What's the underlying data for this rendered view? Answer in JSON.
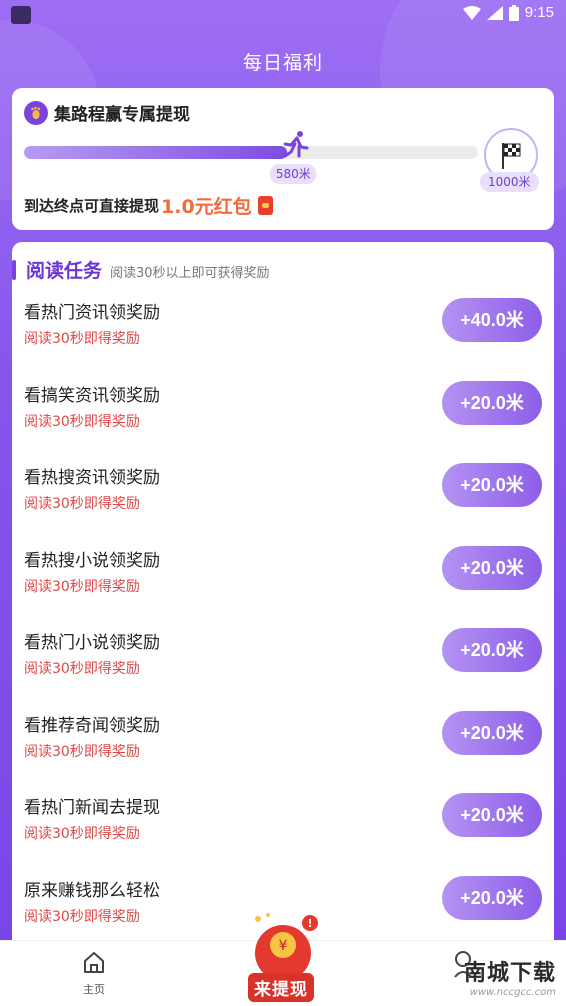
{
  "status_bar": {
    "time": "9:15"
  },
  "page_title": "每日福利",
  "progress": {
    "title": "集路程赢专属提现",
    "current_label": "580米",
    "current_fraction": 0.58,
    "goal_label": "1000米",
    "footer_text": "到达终点可直接提现",
    "footer_amount": "1.0元红包"
  },
  "tasks": {
    "title": "阅读任务",
    "subtitle": "阅读30秒以上即可获得奖励",
    "items": [
      {
        "name": "看热门资讯领奖励",
        "desc": "阅读30秒即得奖励",
        "reward": "+40.0米"
      },
      {
        "name": "看搞笑资讯领奖励",
        "desc": "阅读30秒即得奖励",
        "reward": "+20.0米"
      },
      {
        "name": "看热搜资讯领奖励",
        "desc": "阅读30秒即得奖励",
        "reward": "+20.0米"
      },
      {
        "name": "看热搜小说领奖励",
        "desc": "阅读30秒即得奖励",
        "reward": "+20.0米"
      },
      {
        "name": "看热门小说领奖励",
        "desc": "阅读30秒即得奖励",
        "reward": "+20.0米"
      },
      {
        "name": "看推荐奇闻领奖励",
        "desc": "阅读30秒即得奖励",
        "reward": "+20.0米"
      },
      {
        "name": "看热门新闻去提现",
        "desc": "阅读30秒即得奖励",
        "reward": "+20.0米"
      },
      {
        "name": "原来赚钱那么轻松",
        "desc": "阅读30秒即得奖励",
        "reward": "+20.0米"
      }
    ]
  },
  "bottom_nav": {
    "home_label": "主页",
    "center_label": "来提现"
  },
  "watermark": {
    "main": "南城下载",
    "sub": "www.nccgcc.com"
  },
  "colors": {
    "accent": "#7a44d9",
    "reward_text": "#f36b3c",
    "desc_text": "#e04646"
  }
}
